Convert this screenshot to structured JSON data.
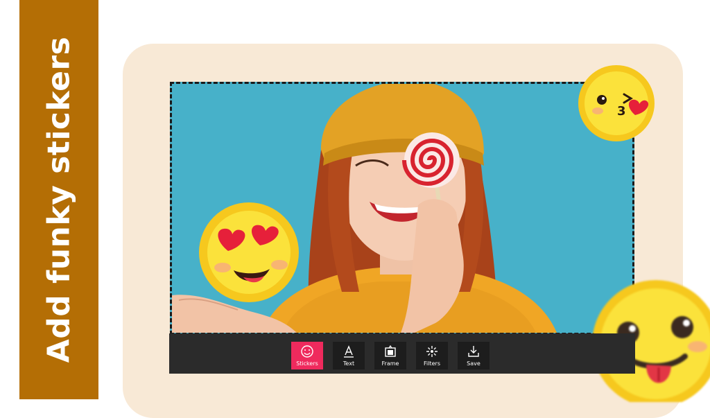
{
  "banner": {
    "title": "Add funky stickers"
  },
  "theme": {
    "band": "#b46e05",
    "card": "#f8e9d6",
    "photo_bg": "#47b1c9",
    "toolbar": "#2b2b2b",
    "active": "#ef2a5d"
  },
  "toolbar": {
    "tools": [
      {
        "label": "Stickers",
        "icon": "smiley-icon",
        "active": true
      },
      {
        "label": "Text",
        "icon": "text-icon",
        "active": false
      },
      {
        "label": "Frame",
        "icon": "frame-icon",
        "active": false
      },
      {
        "label": "Filters",
        "icon": "filters-icon",
        "active": false
      },
      {
        "label": "Save",
        "icon": "download-icon",
        "active": false
      }
    ]
  },
  "stickers": [
    "heart-eyes-emoji",
    "kissing-wink-emoji",
    "tongue-out-emoji"
  ]
}
